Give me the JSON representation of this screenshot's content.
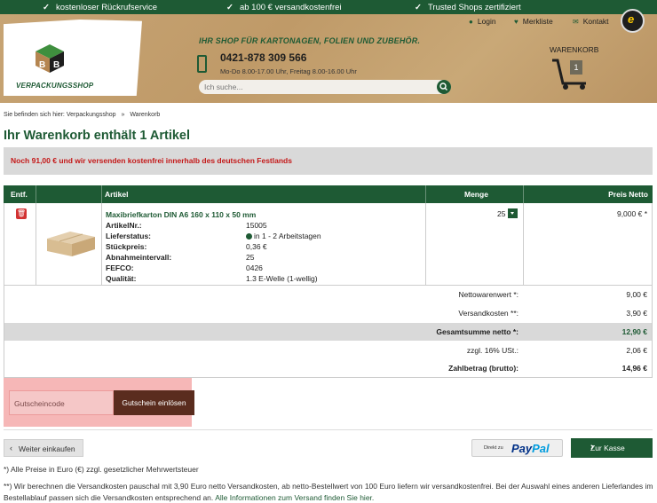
{
  "topbar": {
    "items": [
      "kostenloser Rückrufservice",
      "ab 100 € versandkostenfrei",
      "Trusted Shops zertifiziert"
    ]
  },
  "header": {
    "logo_text": "VERPACKUNGSSHOP",
    "slogan": "IHR SHOP FÜR KARTONAGEN, FOLIEN UND ZUBEHÖR.",
    "phone": "0421-878 309 566",
    "hours": "Mo-Do 8.00-17.00 Uhr, Freitag 8.00-16.00 Uhr",
    "search_placeholder": "Ich suche...",
    "login_label": "Login",
    "wishlist_label": "Merkliste",
    "contact_label": "Kontakt",
    "cart_label": "WARENKORB",
    "cart_count": "1"
  },
  "breadcrumb": {
    "prefix": "Sie befinden sich hier:",
    "items": [
      "Verpackungsshop",
      "Warenkorb"
    ]
  },
  "page_title": "Ihr Warenkorb enthält 1 Artikel",
  "notice": "Noch 91,00 € und wir versenden kostenfrei innerhalb des deutschen Festlands",
  "table": {
    "headers": [
      "Entf.",
      "Artikel",
      "Menge",
      "Preis Netto"
    ],
    "item": {
      "name": "Maxibriefkarton DIN A6 160 x 110 x 50 mm",
      "attributes": [
        {
          "label": "ArtikelNr.:",
          "value": "15005"
        },
        {
          "label": "Lieferstatus:",
          "value": "in 1 - 2 Arbeitstagen"
        },
        {
          "label": "Stückpreis:",
          "value": "0,36 €"
        },
        {
          "label": "Abnahmeintervall:",
          "value": "25"
        },
        {
          "label": "FEFCO:",
          "value": "0426"
        },
        {
          "label": "Qualität:",
          "value": "1.3 E-Welle (1-wellig)"
        }
      ],
      "quantity": "25",
      "price": "9,000 € *"
    }
  },
  "totals": [
    {
      "label": "Nettowarenwert *:",
      "value": "9,00 €"
    },
    {
      "label": "Versandkosten **:",
      "value": "3,90 €"
    },
    {
      "label": "Gesamtsumme netto *:",
      "value": "12,90 €"
    },
    {
      "label": "zzgl. 16% USt.:",
      "value": "2,06 €"
    },
    {
      "label": "Zahlbetrag (brutto):",
      "value": "14,96 €"
    }
  ],
  "coupon": {
    "placeholder": "Gutscheincode",
    "button_label": "Gutschein einlösen"
  },
  "actions": {
    "back_label": "Weiter einkaufen",
    "paypal_direct": "Direkt zu",
    "paypal_pay": "Pay",
    "paypal_pal": "Pal",
    "checkout_label": "Zur Kasse"
  },
  "footer": {
    "note1": "*) Alle Preise in Euro (€) zzgl. gesetzlicher Mehrwertsteuer",
    "note2": "**) Wir berechnen die Versandkosten pauschal mit 3,90 Euro netto Versandkosten, ab netto-Bestellwert von 100 Euro liefern wir versandkostenfrei. Bei der Auswahl eines anderen Lieferlandes im Bestellablauf passen sich die Versandkosten entsprechend an.",
    "link": "Alle Informationen zum Versand finden Sie hier."
  },
  "colors": {
    "brand_green": "#1e5a34",
    "notice_red": "#c41818",
    "coupon_brown": "#5a2c1e"
  }
}
